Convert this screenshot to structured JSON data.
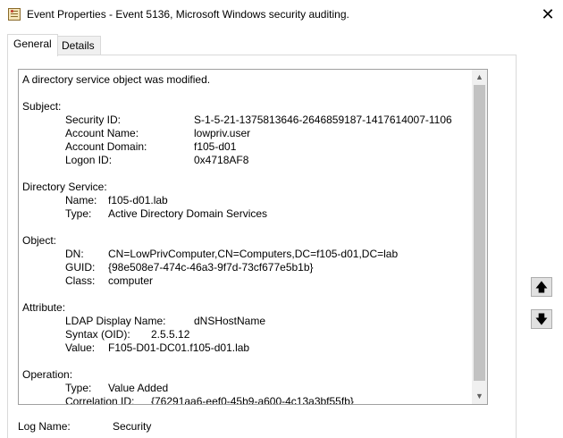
{
  "window": {
    "title": "Event Properties - Event 5136, Microsoft Windows security auditing.",
    "close_glyph": "✕",
    "icon": "event-log-icon"
  },
  "tabs": [
    {
      "label": "General",
      "active": true
    },
    {
      "label": "Details",
      "active": false
    }
  ],
  "description": {
    "summary": "A directory service object was modified.",
    "subject": {
      "heading": "Subject:",
      "rows": [
        {
          "label": "Security ID:",
          "value": "S-1-5-21-1375813646-2646859187-1417614007-1106"
        },
        {
          "label": "Account Name:",
          "value": "lowpriv.user"
        },
        {
          "label": "Account Domain:",
          "value": "f105-d01"
        },
        {
          "label": "Logon ID:",
          "value": "0x4718AF8"
        }
      ]
    },
    "directory_service": {
      "heading": "Directory Service:",
      "rows": [
        {
          "label": "Name:",
          "value": "f105-d01.lab"
        },
        {
          "label": "Type:",
          "value": "Active Directory Domain Services"
        }
      ]
    },
    "object": {
      "heading": "Object:",
      "rows": [
        {
          "label": "DN:",
          "value": "CN=LowPrivComputer,CN=Computers,DC=f105-d01,DC=lab"
        },
        {
          "label": "GUID:",
          "value": "{98e508e7-474c-46a3-9f7d-73cf677e5b1b}"
        },
        {
          "label": "Class:",
          "value": "computer"
        }
      ]
    },
    "attribute": {
      "heading": "Attribute:",
      "rows": [
        {
          "label": "LDAP Display Name:",
          "value": "dNSHostName"
        },
        {
          "label": "Syntax (OID):",
          "value": "2.5.5.12"
        },
        {
          "label": "Value:",
          "value": "F105-D01-DC01.f105-d01.lab"
        }
      ]
    },
    "operation": {
      "heading": "Operation:",
      "rows": [
        {
          "label": "Type:",
          "value": "Value Added"
        },
        {
          "label": "Correlation ID:",
          "value": "{76291aa6-eef0-45b9-a600-4c13a3bf55fb}"
        }
      ]
    }
  },
  "navigation": {
    "up_icon": "up-arrow-icon",
    "down_icon": "down-arrow-icon",
    "up_glyph": "🡅",
    "down_glyph": "🡇"
  },
  "scrollbar": {
    "up_glyph": "▲",
    "down_glyph": "▼"
  },
  "fields": {
    "log_name_label": "Log Name:",
    "log_name_value": "Security"
  }
}
